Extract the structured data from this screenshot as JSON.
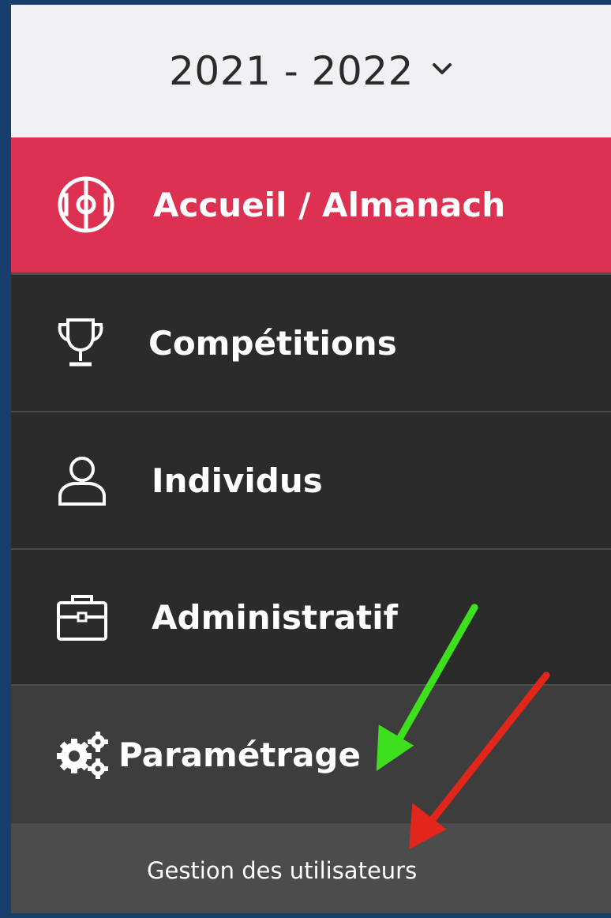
{
  "season": {
    "label": "2021 - 2022"
  },
  "menu": {
    "items": [
      {
        "label": "Accueil / Almanach",
        "icon": "football-field-icon",
        "state": "active"
      },
      {
        "label": "Compétitions",
        "icon": "trophy-icon"
      },
      {
        "label": "Individus",
        "icon": "user-icon"
      },
      {
        "label": "Administratif",
        "icon": "briefcase-icon"
      },
      {
        "label": "Paramétrage",
        "icon": "gears-icon",
        "state": "expanded"
      }
    ],
    "subitems": [
      {
        "label": "Gestion des utilisateurs"
      }
    ]
  },
  "colors": {
    "active_bg": "#dc3150",
    "menu_bg": "#2b2b2b",
    "expanded_bg": "#3d3d3d",
    "submenu_bg": "#4c4c4c",
    "arrow_green": "#3ee01e",
    "arrow_red": "#e3261c"
  },
  "annotations": [
    {
      "icon": "green-arrow-icon",
      "points_to": "Paramétrage"
    },
    {
      "icon": "red-arrow-icon",
      "points_to": "Gestion des utilisateurs"
    }
  ]
}
